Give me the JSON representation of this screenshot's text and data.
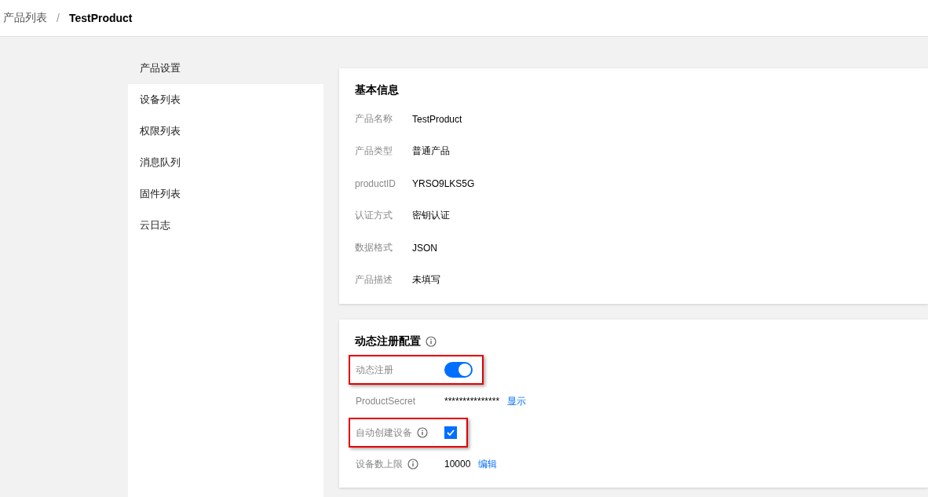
{
  "breadcrumb": {
    "parent": "产品列表",
    "separator": "/",
    "current": "TestProduct"
  },
  "sidebar": {
    "items": [
      {
        "label": "产品设置",
        "selected": true
      },
      {
        "label": "设备列表",
        "selected": false
      },
      {
        "label": "权限列表",
        "selected": false
      },
      {
        "label": "消息队列",
        "selected": false
      },
      {
        "label": "固件列表",
        "selected": false
      },
      {
        "label": "云日志",
        "selected": false
      }
    ]
  },
  "basic_info": {
    "title": "基本信息",
    "rows": [
      {
        "label": "产品名称",
        "value": "TestProduct"
      },
      {
        "label": "产品类型",
        "value": "普通产品"
      },
      {
        "label": "productID",
        "value": "YRSO9LKS5G"
      },
      {
        "label": "认证方式",
        "value": "密钥认证"
      },
      {
        "label": "数据格式",
        "value": "JSON"
      },
      {
        "label": "产品描述",
        "value": "未填写"
      }
    ]
  },
  "dynamic_registration": {
    "title": "动态注册配置",
    "rows": [
      {
        "kind": "toggle",
        "label": "动态注册",
        "on": true,
        "highlighted": true
      },
      {
        "kind": "secret",
        "label": "ProductSecret",
        "value": "***************",
        "link": "显示",
        "highlighted": false
      },
      {
        "kind": "checkbox",
        "label": "自动创建设备",
        "info": true,
        "checked": true,
        "highlighted": true
      },
      {
        "kind": "limit",
        "label": "设备数上限",
        "info": true,
        "value": "10000",
        "link": "编辑",
        "highlighted": false
      }
    ]
  }
}
